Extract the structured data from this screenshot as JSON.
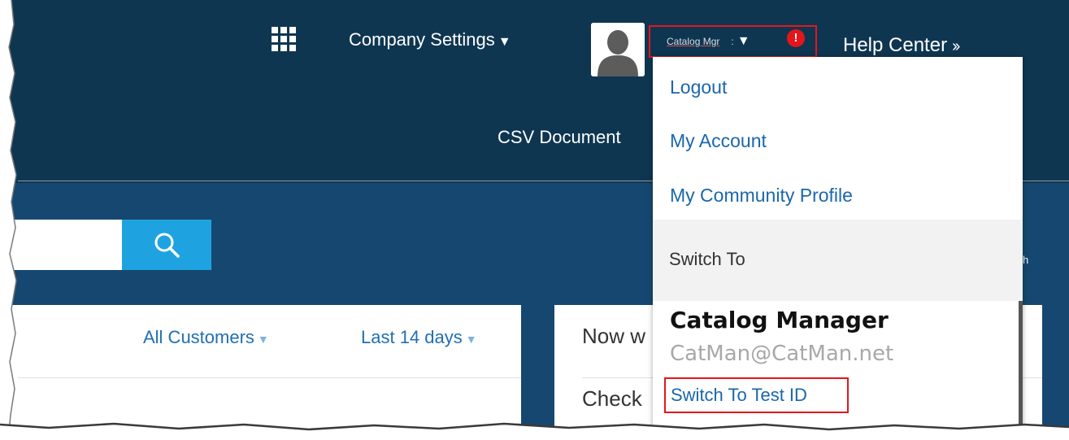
{
  "header": {
    "apps_icon": "grid-icon",
    "company_settings": "Company Settings",
    "user_short_name": "Catalog Mgr",
    "user_separator": ":",
    "alert_badge": "!",
    "help_center": "Help Center",
    "help_center_chevron": "››",
    "dropdown_caret": "▼"
  },
  "nav": {
    "csv_documents": "CSV Document"
  },
  "filters": {
    "customers": "All Customers",
    "range": "Last 14 days",
    "caret": "▼"
  },
  "right_panel": {
    "line1": "Now w",
    "line2": "Check",
    "side_text": "h"
  },
  "dropdown": {
    "items": [
      {
        "label": "Logout"
      },
      {
        "label": "My Account"
      },
      {
        "label": "My Community Profile"
      }
    ],
    "switch_to_label": "Switch To",
    "account_name": "Catalog Manager",
    "account_email": "CatMan@CatMan.net",
    "switch_test_label": "Switch To Test ID"
  },
  "colors": {
    "header_bg": "#0f3651",
    "main_bg": "#164770",
    "search_btn": "#1fa3e0",
    "link": "#1b67ab",
    "highlight_border": "#e4161b"
  },
  "icons": {
    "search": "search-icon",
    "avatar": "user-avatar-icon",
    "alert": "alert-icon"
  }
}
